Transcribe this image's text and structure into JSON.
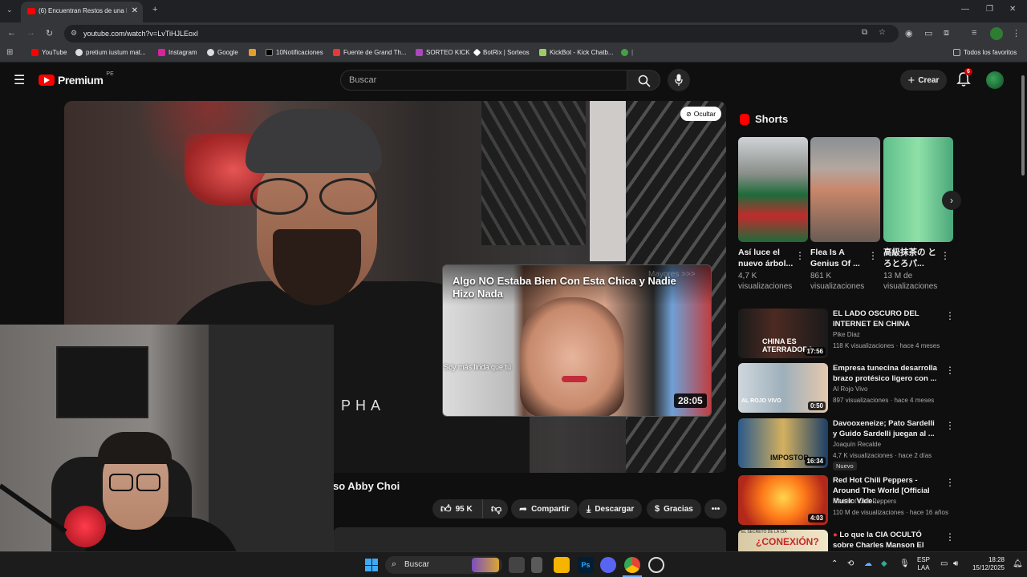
{
  "browser": {
    "tab_title": "(6) Encuentran Restos de una In",
    "url": "youtube.com/watch?v=LvTiHJLEoxI",
    "bookmarks": [
      "YouTube",
      "pretium iustum mat...",
      "Instagram",
      "Google",
      "10Notificaciones",
      "Fuente de Grand Th...",
      "SORTEO KICK",
      "BotRix | Sorteos",
      "KickBot - Kick Chatb...",
      "Todos los favoritos"
    ]
  },
  "youtube": {
    "logo": "Premium",
    "region": "PE",
    "search_placeholder": "Buscar",
    "create_label": "Crear",
    "notif_count": "6",
    "hide_label": "Ocultar",
    "video_title_partial": "so Abby Choi",
    "overlay_text": "PHA",
    "actions": {
      "likes": "95 K",
      "share": "Compartir",
      "download": "Descargar",
      "thanks": "Gracias"
    },
    "card": {
      "title": "Algo NO Estaba Bien Con Esta Chica y Nadie Hizo Nada",
      "subtitle": "Soy más linda que tú",
      "duration": "28:05",
      "faded": "Mayores >>>"
    },
    "shorts_heading": "Shorts",
    "shorts": [
      {
        "title": "Así luce el nuevo árbol...",
        "views": "4,7 K visualizaciones"
      },
      {
        "title": "Flea Is A Genius Of ...",
        "views": "861 K visualizaciones"
      },
      {
        "title": "高級抹茶の とろとろパ...",
        "views": "13 M de visualizaciones"
      }
    ],
    "related": [
      {
        "title": "EL LADO OSCURO DEL INTERNET EN CHINA",
        "channel": "Pike Diaz",
        "meta": "118 K visualizaciones · hace 4 meses",
        "duration": "17:56",
        "thumb_text": "CHINA ES ATERRADORA"
      },
      {
        "title": "Empresa tunecina desarrolla brazo protésico ligero con ...",
        "channel": "Al Rojo Vivo",
        "meta": "897 visualizaciones · hace 4 meses",
        "duration": "0:50",
        "thumb_text": "AL ROJO VIVO"
      },
      {
        "title": "Davooxeneize; Pato Sardelli y Guido Sardelli juegan al ...",
        "channel": "Joaquín Recalde",
        "meta": "4,7 K visualizaciones · hace 2 días",
        "duration": "16:34",
        "badge": "Nuevo",
        "thumb_text": "IMPOSTOR"
      },
      {
        "title": "Red Hot Chili Peppers - Around The World [Official Music Vide...",
        "channel": "Red Hot Chili Peppers",
        "meta": "110 M de visualizaciones · hace 16 años",
        "duration": "4:03",
        "thumb_text": ""
      },
      {
        "title": "Lo que la CIA OCULTÓ sobre Charles Manson El Experiment...",
        "channel": "",
        "meta": "",
        "duration": "",
        "thumb_text": "¿CONEXIÓN?",
        "thumb_small": "EL SECRETO DE LA CIA"
      }
    ]
  },
  "taskbar": {
    "search": "Buscar",
    "lang": "ESP",
    "lang2": "LAA",
    "time": "18:28",
    "date": "15/12/2025"
  },
  "colors": {
    "accent": "#ff0000",
    "bg": "#0f0f0f"
  }
}
